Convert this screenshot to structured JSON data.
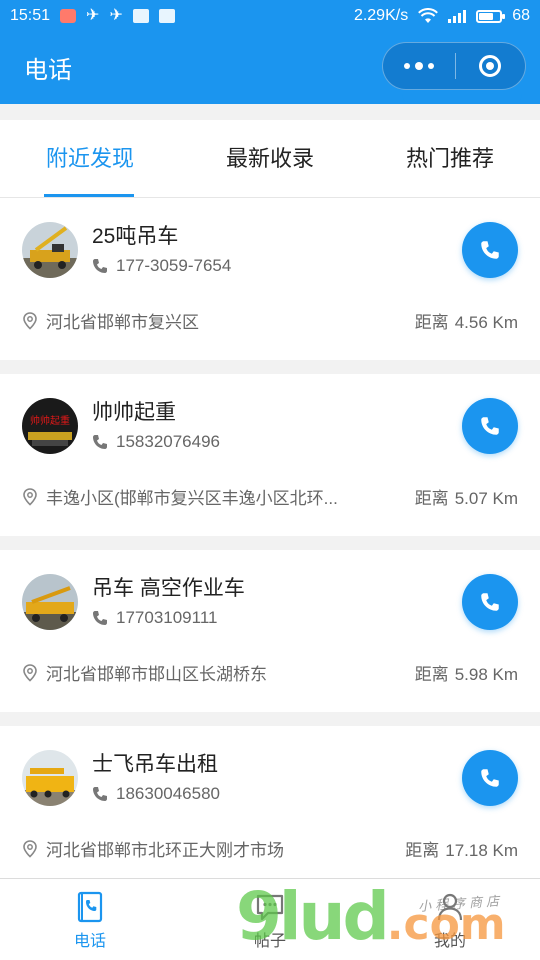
{
  "status_bar": {
    "time": "15:51",
    "net_speed": "2.29K/s",
    "battery": "68",
    "battery_level": 0.68
  },
  "header": {
    "title": "电话"
  },
  "tabs": [
    {
      "label": "附近发现",
      "active": true
    },
    {
      "label": "最新收录",
      "active": false
    },
    {
      "label": "热门推荐",
      "active": false
    }
  ],
  "listings": [
    {
      "name": "25吨吊车",
      "phone": "177-3059-7654",
      "address": "河北省邯郸市复兴区",
      "distance_label": "距离",
      "distance": "4.56 Km"
    },
    {
      "name": "帅帅起重",
      "phone": "15832076496",
      "address": "丰逸小区(邯郸市复兴区丰逸小区北环...",
      "distance_label": "距离",
      "distance": "5.07 Km",
      "avatar_text": "帅帅起重"
    },
    {
      "name": "吊车 高空作业车",
      "phone": "17703109111",
      "address": "河北省邯郸市邯山区长湖桥东",
      "distance_label": "距离",
      "distance": "5.98 Km"
    },
    {
      "name": "士飞吊车出租",
      "phone": "18630046580",
      "address": "河北省邯郸市北环正大刚才市场",
      "distance_label": "距离",
      "distance": "17.18 Km"
    }
  ],
  "bottom_nav": [
    {
      "label": "电话",
      "icon": "phone-book-icon",
      "active": true
    },
    {
      "label": "帖子",
      "icon": "chat-bubble-icon",
      "active": false
    },
    {
      "label": "我的",
      "icon": "person-icon",
      "active": false
    }
  ],
  "watermark": {
    "main": "9lud",
    "suffix": ".com",
    "small": "小程序商店"
  },
  "colors": {
    "primary": "#1b95ef",
    "text": "#222222",
    "secondary_text": "#666666",
    "background": "#f2f2f2"
  }
}
